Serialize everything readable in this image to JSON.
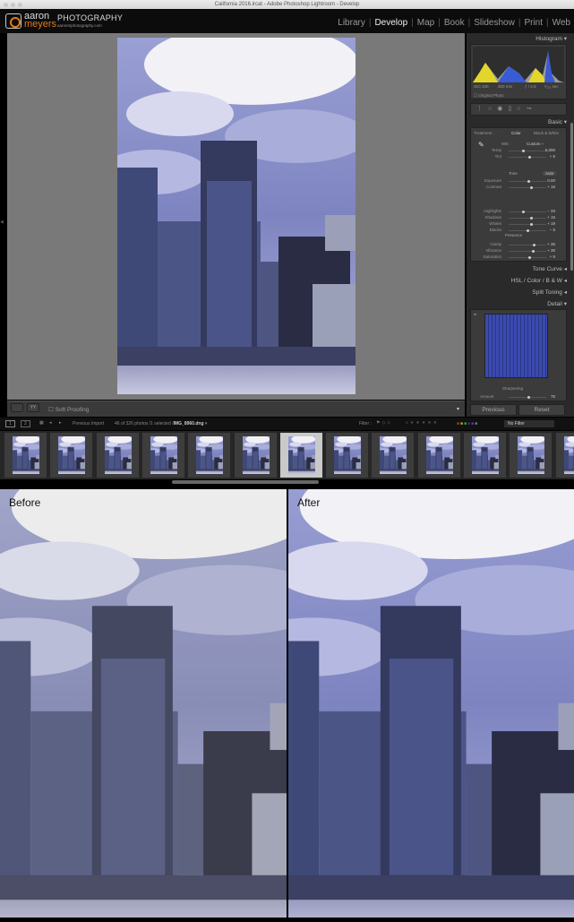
{
  "window": {
    "title": "California 2016.lrcat - Adobe Photoshop Lightroom - Develop"
  },
  "brand": {
    "line1": "aaron",
    "line2": "meyers",
    "name": "PHOTOGRAPHY",
    "url": "aaronmphotography.com"
  },
  "nav": [
    {
      "label": "Library"
    },
    {
      "label": "Develop",
      "active": true
    },
    {
      "label": "Map"
    },
    {
      "label": "Book"
    },
    {
      "label": "Slideshow"
    },
    {
      "label": "Print"
    },
    {
      "label": "Web"
    }
  ],
  "histogram": {
    "title": "Histogram",
    "iso": "ISO 100",
    "focal": "300 mm",
    "aperture": "ƒ / 2.8",
    "shutter": "¹⁄₁₂₅ sec",
    "original_photo": "Original Photo"
  },
  "basic": {
    "title": "Basic",
    "treatment_label": "Treatment :",
    "color": "Color",
    "bw": "Black & White",
    "wb_label": "WB :",
    "wb_value": "Custom",
    "wb": [
      {
        "label": "Temp",
        "value": "5,000",
        "pos": 0.35
      },
      {
        "label": "Tint",
        "value": "+ 5",
        "pos": 0.52
      }
    ],
    "tone_label": "Tone",
    "auto": "Auto",
    "tone": [
      {
        "label": "Exposure",
        "value": "0.00",
        "pos": 0.5
      },
      {
        "label": "Contrast",
        "value": "+ 15",
        "pos": 0.57
      }
    ],
    "tone2": [
      {
        "label": "Highlights",
        "value": "− 33",
        "pos": 0.35
      },
      {
        "label": "Shadows",
        "value": "+ 15",
        "pos": 0.57
      },
      {
        "label": "Whites",
        "value": "+ 19",
        "pos": 0.58
      },
      {
        "label": "Blacks",
        "value": "− 5",
        "pos": 0.47
      }
    ],
    "presence_label": "Presence",
    "presence": [
      {
        "label": "Clarity",
        "value": "+ 35",
        "pos": 0.65
      },
      {
        "label": "Vibrance",
        "value": "+ 30",
        "pos": 0.62
      },
      {
        "label": "Saturation",
        "value": "+ 5",
        "pos": 0.52
      }
    ]
  },
  "panels": {
    "tone_curve": "Tone Curve",
    "hsl": "HSL  /  Color  /  B & W",
    "split_toning": "Split Toning",
    "detail": "Detail"
  },
  "detail": {
    "sharpening": "Sharpening",
    "amount_label": "Amount",
    "amount": "75",
    "amount_pos": 0.5
  },
  "buttons": {
    "previous": "Previous",
    "reset": "Reset"
  },
  "toolbar": {
    "soft_proofing": "Soft Proofing"
  },
  "filmstrip": {
    "page1": "1",
    "page2": "2",
    "source": "Previous Import",
    "status": "46 of 326 photos /1 selected /",
    "filename": "IMG_8960.dng",
    "filter_label": "Filter :",
    "filter_value": "No Filter",
    "count": 13,
    "selected_index": 6
  },
  "compare": {
    "before": "Before",
    "after": "After"
  },
  "colors": {
    "accent": "#e07a1f",
    "sky": "#8d93c8"
  }
}
